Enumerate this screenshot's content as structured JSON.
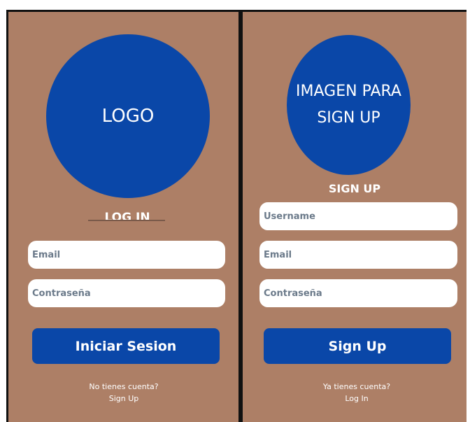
{
  "login": {
    "logo_text": "LOGO",
    "heading": "LOG IN",
    "email_placeholder": "Email",
    "password_placeholder": "Contraseña",
    "submit_label": "Iniciar Sesion",
    "footer_question": "No tienes cuenta?",
    "footer_link": "Sign Up"
  },
  "signup": {
    "image_text": "IMAGEN PARA SIGN UP",
    "heading": "SIGN UP",
    "username_placeholder": "Username",
    "email_placeholder": "Email",
    "password_placeholder": "Contraseña",
    "submit_label": "Sign Up",
    "footer_question": "Ya tienes cuenta?",
    "footer_link": "Log In"
  },
  "colors": {
    "background": "#ad7f66",
    "primary": "#0a47a8",
    "field": "#ffffff",
    "text_light": "#ffffff"
  }
}
